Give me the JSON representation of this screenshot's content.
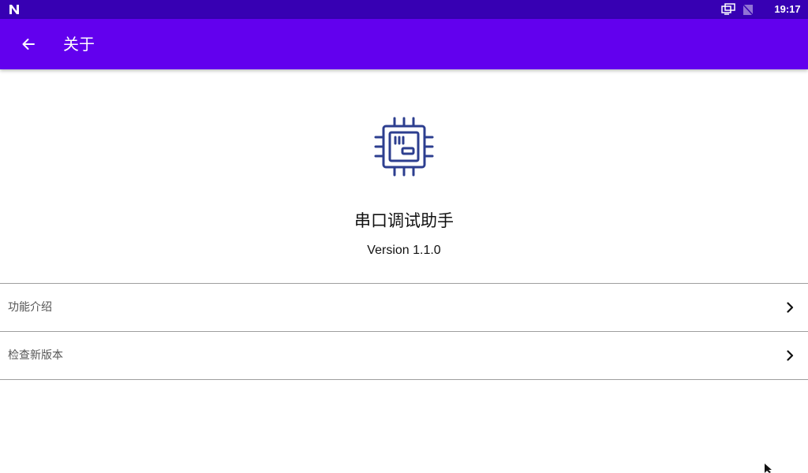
{
  "status_bar": {
    "time": "19:17",
    "background": "#3700b3",
    "icons": [
      "n-logo-icon",
      "screen-cast-icon",
      "no-signal-icon"
    ]
  },
  "app_bar": {
    "title": "关于",
    "back_icon": "arrow-left-icon",
    "background": "#6200ee"
  },
  "about": {
    "app_name": "串口调试助手",
    "version": "Version 1.1.0",
    "logo_icon": "chip-icon",
    "logo_color": "#2c3e8f"
  },
  "menu": {
    "items": [
      {
        "label": "功能介绍",
        "icon": "chevron-right-icon"
      },
      {
        "label": "检查新版本",
        "icon": "chevron-right-icon"
      }
    ]
  }
}
